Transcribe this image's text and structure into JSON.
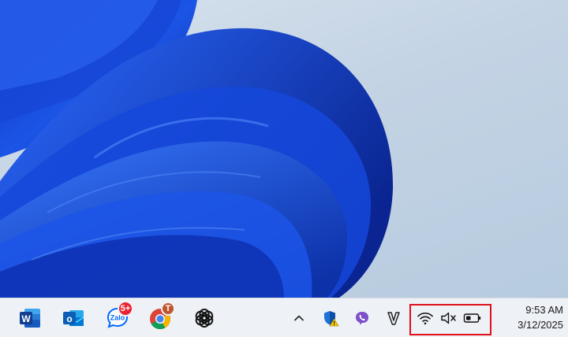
{
  "taskbar": {
    "pinned": [
      {
        "name": "word-icon",
        "letter": "W"
      },
      {
        "name": "outlook-icon",
        "letter": "o"
      },
      {
        "name": "zalo-icon",
        "text": "Zalo",
        "badge": "5+"
      },
      {
        "name": "chrome-icon",
        "profile_letter": "T"
      },
      {
        "name": "chatgpt-icon"
      }
    ],
    "tray": {
      "overflow": "chevron-up-icon",
      "apps": [
        "windows-security-icon",
        "viber-icon",
        "vpn-v-icon"
      ],
      "status": [
        "wifi-icon",
        "speaker-muted-icon",
        "battery-icon"
      ]
    },
    "clock": {
      "time": "9:53 AM",
      "date": "3/12/2025"
    }
  },
  "colors": {
    "accent": "#1e4fd8",
    "highlight": "#e0101a",
    "taskbar_bg": "#eef1f6"
  }
}
